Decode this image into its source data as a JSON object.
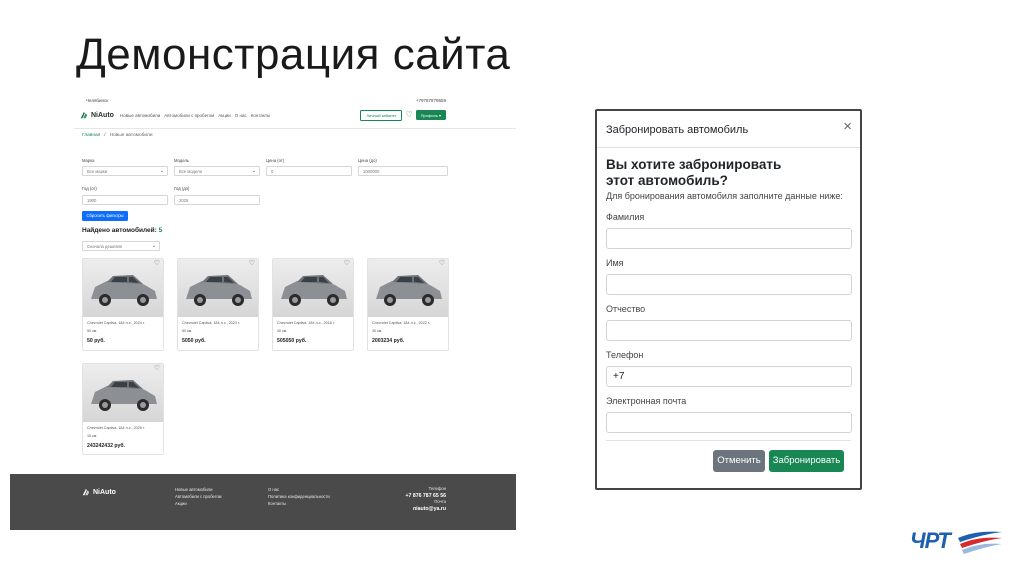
{
  "slide": {
    "title": "Демонстрация сайта",
    "logo_text": "ЧРТ"
  },
  "site": {
    "city": "Челябинск",
    "phone_top": "+79787879559",
    "brand": "NiAuto",
    "nav": [
      "Новые автомобили",
      "Автомобили с пробегом",
      "Акции",
      "О нас",
      "Контакты"
    ],
    "btn_login": "Личный кабинет",
    "btn_profile": "Профиль ▾",
    "breadcrumb": {
      "home": "Главная",
      "sep": "/",
      "current": "Новые автомобили"
    },
    "filters": {
      "brand_label": "Марка",
      "brand_value": "Все марки",
      "model_label": "Модель",
      "model_value": "Все модели",
      "price_from_label": "Цена (от)",
      "price_from_value": "0",
      "price_to_label": "Цена (до)",
      "price_to_value": "1000000",
      "year_from_label": "Год (от)",
      "year_from_value": "1900",
      "year_to_label": "Год (до)",
      "year_to_value": "2025",
      "reset": "Сбросить фильтры"
    },
    "found_label": "Найдено автомобилей:",
    "found_count": "5",
    "sort_value": "Сначала дешевле",
    "cars": [
      {
        "l1": "Chevrolet Captiva, 184 л.с., 2024 г.",
        "l2": "50 км.",
        "price": "50 руб."
      },
      {
        "l1": "Chevrolet Captiva, 184 л.с., 2023 г.",
        "l2": "50 км.",
        "price": "5050 руб."
      },
      {
        "l1": "Chevrolet Captiva, 184 л.с., 2018 г.",
        "l2": "40 км.",
        "price": "505050 руб."
      },
      {
        "l1": "Chevrolet Captiva, 184 л.с., 2022 г.",
        "l2": "30 км.",
        "price": "2003234 руб."
      },
      {
        "l1": "Chevrolet Captiva, 184 л.с., 2025 г.",
        "l2": "15 км.",
        "price": "243242432 руб."
      }
    ],
    "footer": {
      "brand": "NiAuto",
      "col1": [
        "Новые автомобили",
        "Автомобили с пробегом",
        "Акции"
      ],
      "col2": [
        "О нас",
        "Политика конфиденциальности",
        "Контакты"
      ],
      "phone_label": "Телефон",
      "phone": "+7 876 787 65 56",
      "email_label": "Почта",
      "email": "niauto@ya.ru"
    }
  },
  "modal": {
    "title": "Забронировать автомобиль",
    "close": "×",
    "question": "Вы хотите забронировать этот автомобиль?",
    "subtitle": "Для бронирования автомобиля заполните данные ниже:",
    "fields": [
      {
        "label": "Фамилия",
        "value": ""
      },
      {
        "label": "Имя",
        "value": ""
      },
      {
        "label": "Отчество",
        "value": ""
      },
      {
        "label": "Телефон",
        "value": "+7"
      },
      {
        "label": "Электронная почта",
        "value": ""
      }
    ],
    "cancel": "Отменить",
    "submit": "Забронировать"
  },
  "colors": {
    "brand_green": "#198754",
    "primary_blue": "#0d6efd",
    "footer_gray": "#4a4a4a",
    "cancel_gray": "#6c757d"
  }
}
